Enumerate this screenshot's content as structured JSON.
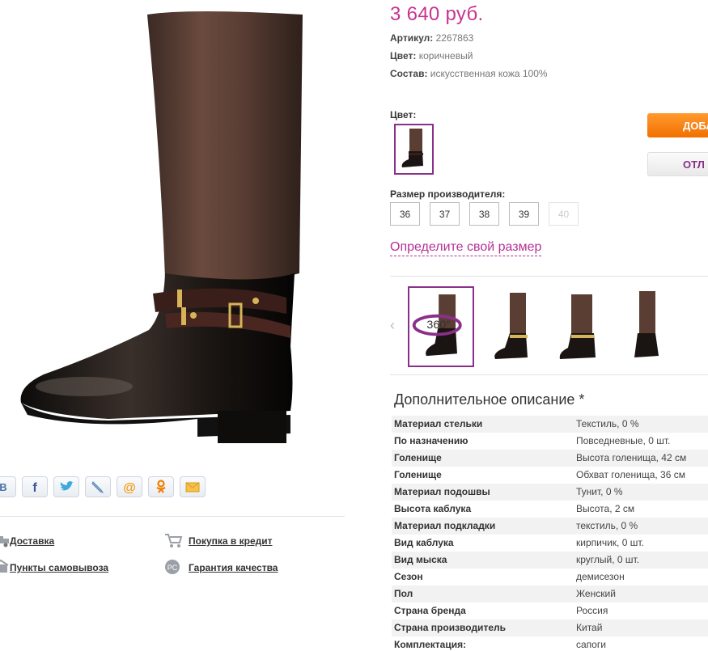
{
  "product": {
    "price": "3 640 руб.",
    "article_label": "Артикул:",
    "article_value": "2267863",
    "color_label": "Цвет:",
    "color_value": "коричневый",
    "composition_label": "Состав:",
    "composition_value": "искусственная кожа 100%"
  },
  "color_picker": {
    "label": "Цвет:"
  },
  "buttons": {
    "add": "ДОБА",
    "defer": "ОТЛ"
  },
  "size_picker": {
    "label": "Размер производителя:",
    "sizes": [
      {
        "value": "36",
        "available": true
      },
      {
        "value": "37",
        "available": true
      },
      {
        "value": "38",
        "available": true
      },
      {
        "value": "39",
        "available": true
      },
      {
        "value": "40",
        "available": false
      }
    ],
    "size_link": "Определите свой размер"
  },
  "gallery": {
    "badge_360": "360°"
  },
  "description": {
    "title": "Дополнительное описание *",
    "rows": [
      {
        "k": "Материал стельки",
        "v": "Текстиль, 0 %"
      },
      {
        "k": "По назначению",
        "v": "Повседневные, 0 шт."
      },
      {
        "k": "Голенище",
        "v": "Высота голенища, 42 см"
      },
      {
        "k": "Голенище",
        "v": "Обхват голенища, 36 см"
      },
      {
        "k": "Материал подошвы",
        "v": "Тунит, 0 %"
      },
      {
        "k": "Высота каблука",
        "v": "Высота, 2 см"
      },
      {
        "k": "Материал подкладки",
        "v": "текстиль, 0 %"
      },
      {
        "k": "Вид каблука",
        "v": "кирпичик, 0 шт."
      },
      {
        "k": "Вид мыска",
        "v": "круглый, 0 шт."
      },
      {
        "k": "Сезон",
        "v": "демисезон"
      },
      {
        "k": "Пол",
        "v": "Женский"
      },
      {
        "k": "Страна бренда",
        "v": "Россия"
      },
      {
        "k": "Страна производитель",
        "v": "Китай"
      },
      {
        "k": "Комплектация:",
        "v": "сапоги"
      }
    ]
  },
  "services": {
    "delivery": "Доставка",
    "credit": "Покупка в кредит",
    "pickup": "Пункты самовывоза",
    "guarantee": "Гарантия качества"
  },
  "social_icons": [
    "vk-icon",
    "facebook-icon",
    "twitter-icon",
    "livejournal-icon",
    "mailru-icon",
    "odnoklassniki-icon",
    "email-icon"
  ],
  "colors": {
    "accent": "#c7348f",
    "selection": "#8a2f8a",
    "cta": "#f26f00"
  }
}
